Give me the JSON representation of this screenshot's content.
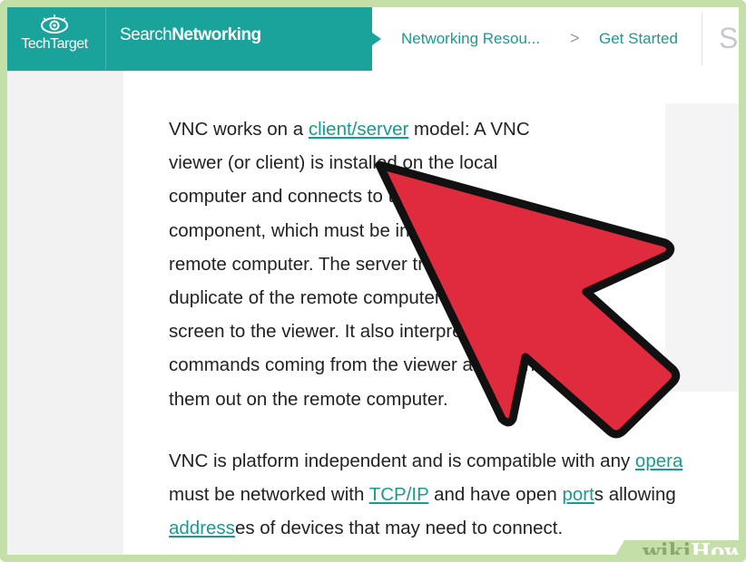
{
  "header": {
    "logo_text": "TechTarget",
    "site_prefix": "Search",
    "site_suffix": "Networking",
    "breadcrumb": [
      "Networking Resou...",
      "Get Started"
    ],
    "breadcrumb_separator": ">",
    "search_text": "Se"
  },
  "article": {
    "paragraph1": [
      {
        "before": "VNC works on a ",
        "link": "client/server",
        "after": " model: A VNC"
      },
      {
        "text": "viewer (or client) is installed on the local"
      },
      {
        "text": "computer and connects to the server"
      },
      {
        "text": "component, which must be installed on the"
      },
      {
        "text": "remote computer. The server transmits a"
      },
      {
        "text": "duplicate of the remote computer's display"
      },
      {
        "text": "screen to the viewer. It also interprets"
      },
      {
        "text": "commands coming from the viewer and carries"
      },
      {
        "text": "them out on the remote computer."
      }
    ],
    "paragraph2": {
      "line1_before": "VNC is platform independent and is compatible with any ",
      "line1_link": "opera",
      "line2_before": "must be networked with ",
      "line2_link1": "TCP/IP",
      "line2_mid": " and have open ",
      "line2_link2": "port",
      "line2_after": "s allowing",
      "line3_link": "address",
      "line3_after": "es of devices that may need to connect."
    }
  },
  "watermark": {
    "wiki": "wiki",
    "how": "How"
  },
  "colors": {
    "brand": "#1aa39a",
    "link": "#1a9a90",
    "pointer": "#e02b3f",
    "frame": "#c5dfa8"
  }
}
